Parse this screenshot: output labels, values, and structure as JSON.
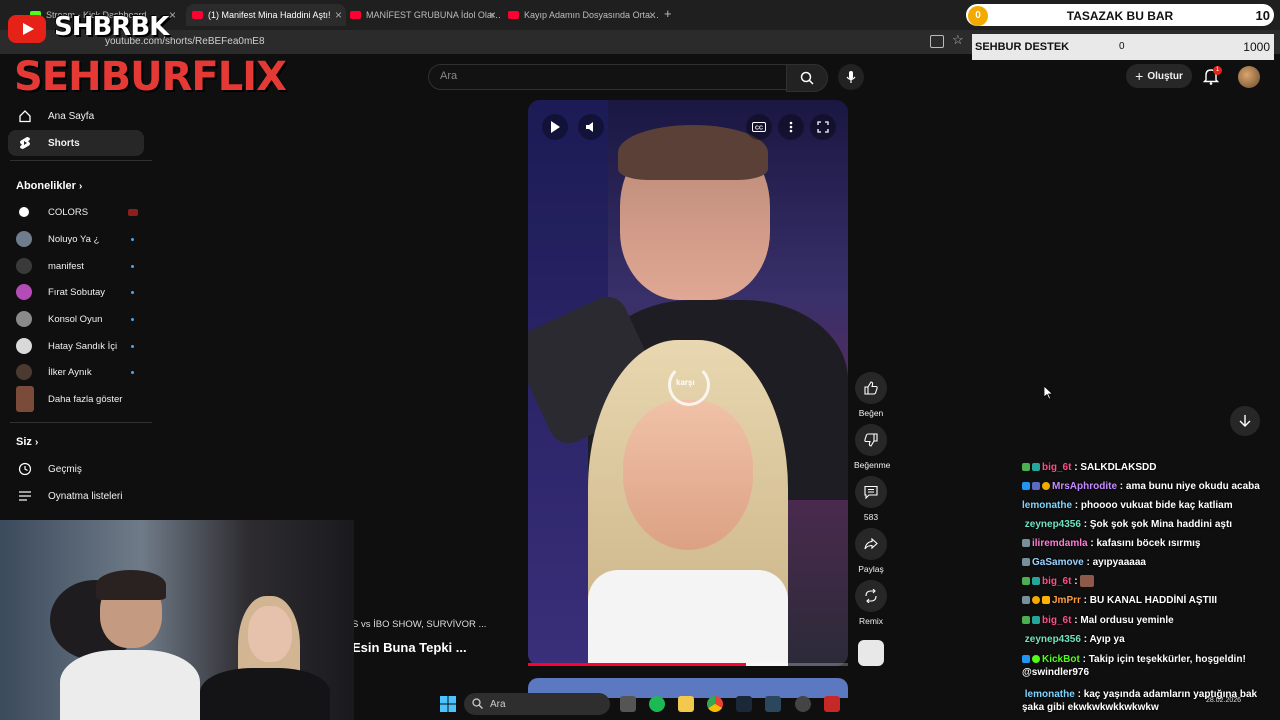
{
  "browser": {
    "tabs": [
      {
        "label": "Stream - Kick Dashboard",
        "active": false,
        "favicon_color": "#53fc18"
      },
      {
        "label": "(1) Manifest Mina Haddini Aştı!",
        "active": true,
        "favicon_color": "#ff0033"
      },
      {
        "label": "MANİFEST GRUBUNA İdol Olar…",
        "active": false,
        "favicon_color": "#ff0033"
      },
      {
        "label": "Kayıp Adamın Dosyasında Orta…",
        "active": false,
        "favicon_color": "#ff0033"
      }
    ],
    "url": "youtube.com/shorts/ReBEFea0mE8"
  },
  "stream_overlay": {
    "channel_tag": "SHBRBK",
    "brand": "SEHBURFLIX",
    "bar": {
      "coin_value": "0",
      "title": "TASAZAK BU BAR",
      "count": "10"
    },
    "support": {
      "title": "SEHBUR DESTEK",
      "current": "0",
      "goal": "1000"
    }
  },
  "youtube": {
    "search_placeholder": "Ara",
    "create_label": "Oluştur",
    "notification_count": "1",
    "nav": [
      {
        "label": "Ana Sayfa",
        "icon": "home-icon",
        "selected": false
      },
      {
        "label": "Shorts",
        "icon": "shorts-icon",
        "selected": true
      }
    ],
    "subscriptions_heading": "Abonelikler",
    "subscriptions": [
      {
        "name": "COLORS",
        "status": "live"
      },
      {
        "name": "Noluyo Ya ¿",
        "status": "new"
      },
      {
        "name": "manifest",
        "status": "new"
      },
      {
        "name": "Fırat Sobutay",
        "status": "new"
      },
      {
        "name": "Konsol Oyun",
        "status": "new"
      },
      {
        "name": "Hatay Sandık İçi",
        "status": "new"
      },
      {
        "name": "İlker Aynık",
        "status": "new"
      },
      {
        "name": "Daha fazla göster",
        "status": ""
      }
    ],
    "you_heading": "Siz",
    "you_items": [
      {
        "label": "Geçmiş",
        "icon": "history-icon"
      },
      {
        "label": "Oynatma listeleri",
        "icon": "playlist-icon"
      }
    ],
    "short": {
      "overlay_text": "karşı",
      "progress_fraction": 0.68,
      "actions": [
        {
          "label": "Beğen",
          "icon": "like-icon"
        },
        {
          "label": "Beğenme",
          "icon": "dislike-icon"
        },
        {
          "label": "583",
          "icon": "comment-icon"
        },
        {
          "label": "Paylaş",
          "icon": "share-icon"
        },
        {
          "label": "Remix",
          "icon": "remix-icon"
        }
      ]
    },
    "adjacent_short": {
      "subtitle": "S vs İBO SHOW, SURVİVOR ...",
      "title": "Esin Buna Tepki ..."
    }
  },
  "chat": [
    {
      "user": "big_6t",
      "color": "#ff4d8d",
      "message": "SALKDLAKSDD"
    },
    {
      "user": "MrsAphrodite",
      "color": "#c48bff",
      "message": "ama bunu niye okudu acaba"
    },
    {
      "user": "lemonathe",
      "color": "#7fd4ff",
      "message": "phoooo vukuat bide kaç katliam"
    },
    {
      "user": "zeynep4356",
      "color": "#6fe3c1",
      "message": "Şok şok şok Mina haddini aştı"
    },
    {
      "user": "iliremdamla",
      "color": "#ff7bd5",
      "message": "kafasını böcek ısırmış"
    },
    {
      "user": "GaSamove",
      "color": "#9ad1ff",
      "message": "ayıpyaaaaa"
    },
    {
      "user": "big_6t",
      "color": "#ff4d8d",
      "message": ""
    },
    {
      "user": "JmPrr",
      "color": "#ff9f43",
      "message": "BU KANAL HADDİNİ AŞTIII"
    },
    {
      "user": "big_6t",
      "color": "#ff4d8d",
      "message": "Mal ordusu yeminle"
    },
    {
      "user": "zeynep4356",
      "color": "#6fe3c1",
      "message": "Ayıp ya"
    },
    {
      "user": "KickBot",
      "color": "#53fc18",
      "message": "Takip için teşekkürler, hoşgeldin! @swindler976"
    },
    {
      "user": "lemonathe",
      "color": "#7fd4ff",
      "message": "kaç yaşında adamların yaptığına bak şaka gibi ekwkwkwkkwkwkw"
    }
  ],
  "taskbar": {
    "search_placeholder": "Ara",
    "date": "28.02.2026"
  }
}
